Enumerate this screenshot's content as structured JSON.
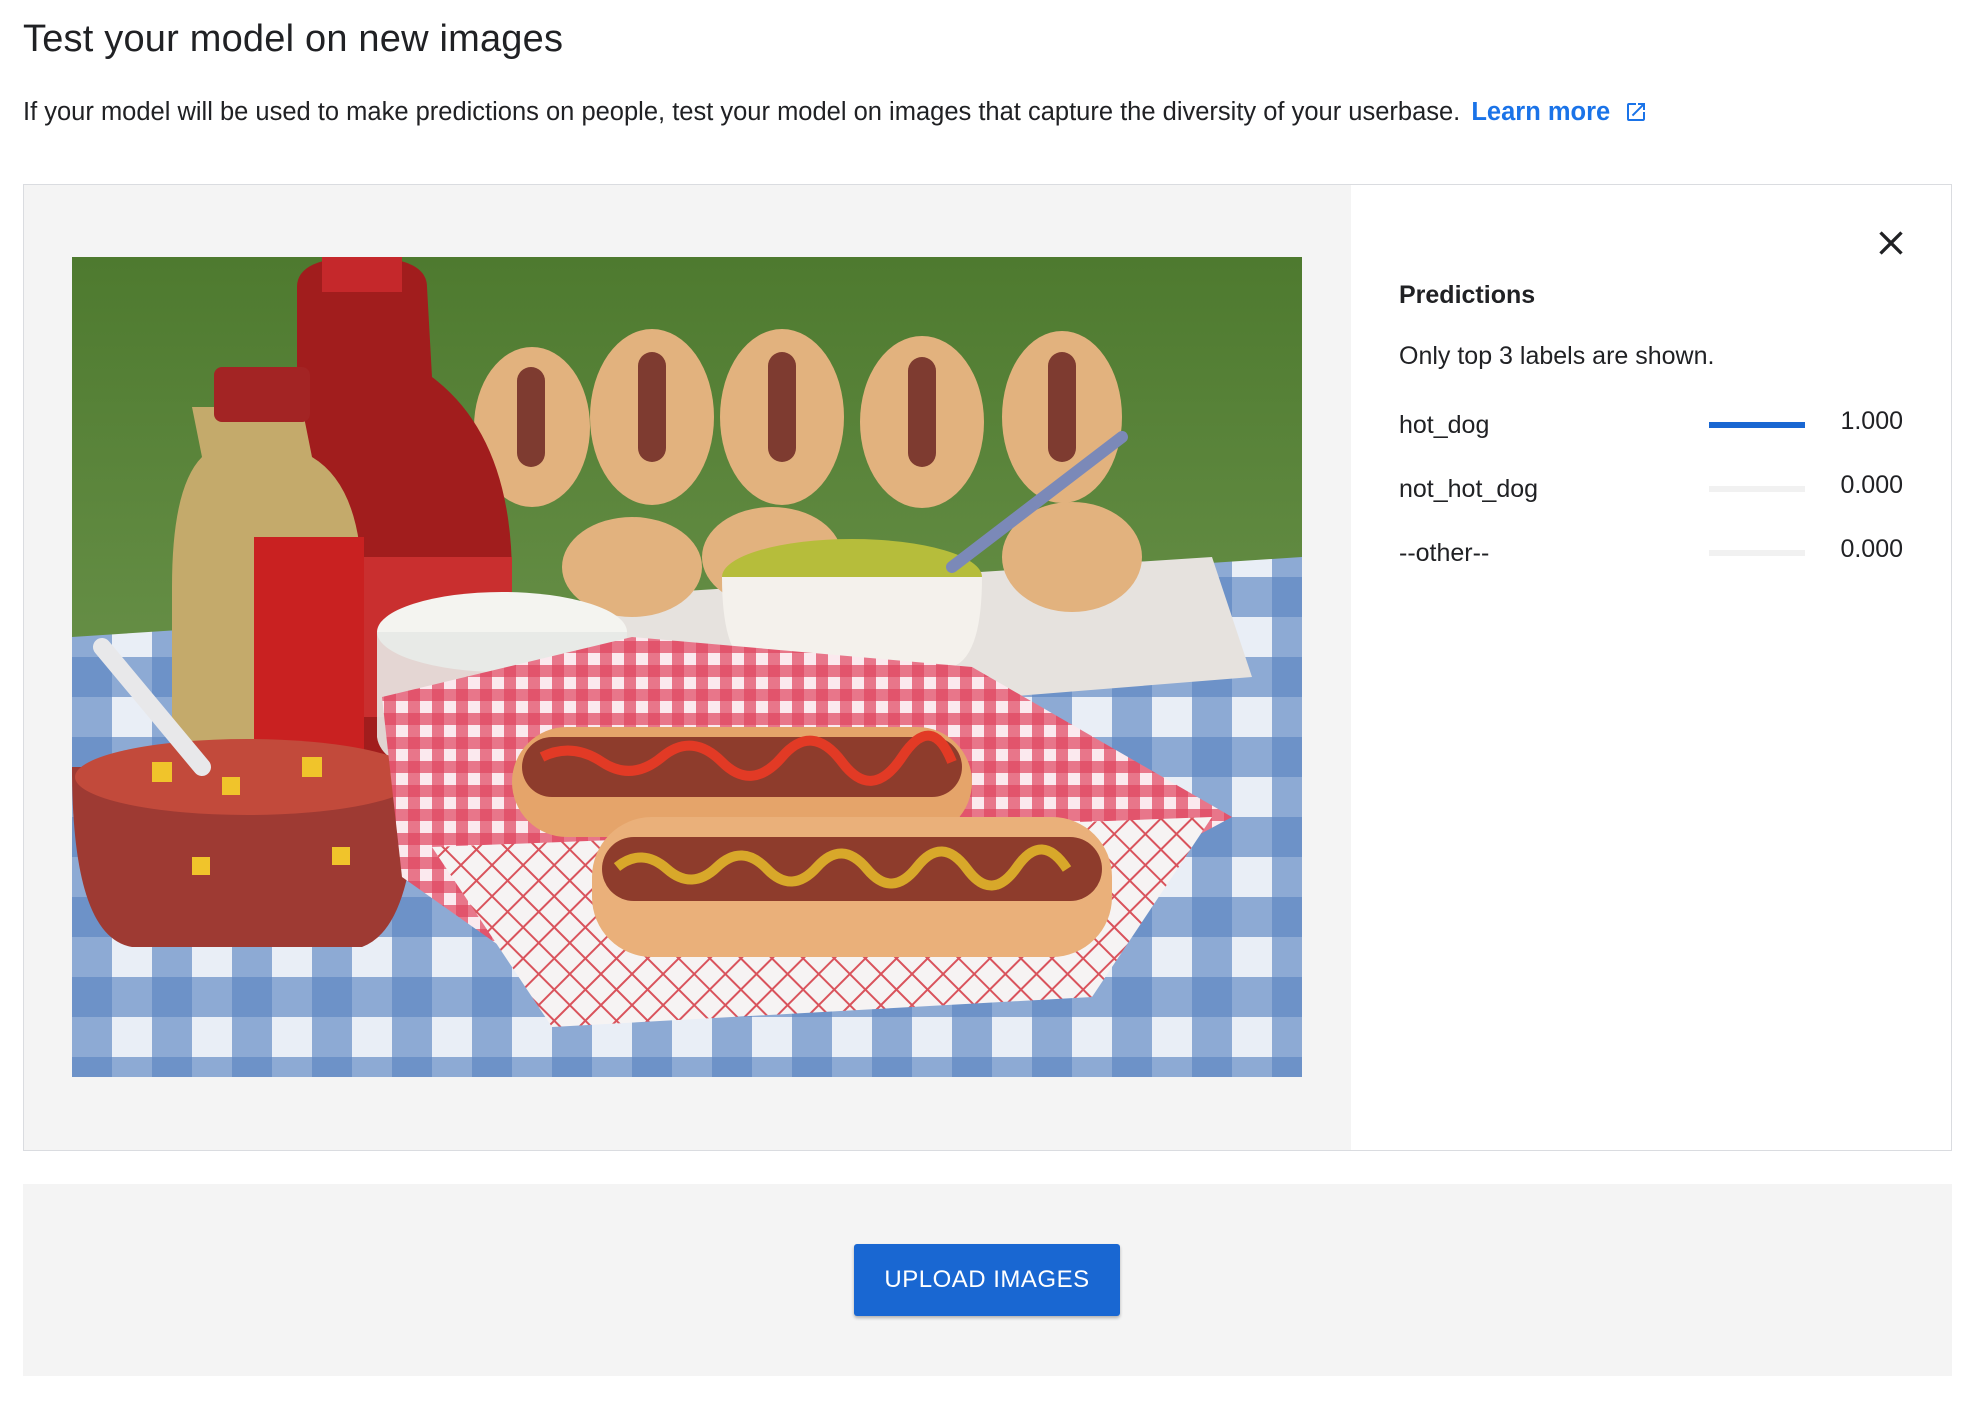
{
  "header": {
    "title": "Test your model on new images",
    "description": "If your model will be used to make predictions on people, test your model on images that capture the diversity of your userbase.",
    "learn_more_label": "Learn more"
  },
  "predictions": {
    "title": "Predictions",
    "note": "Only top 3 labels are shown.",
    "items": [
      {
        "label": "hot_dog",
        "score": 1.0,
        "score_text": "1.000"
      },
      {
        "label": "not_hot_dog",
        "score": 0.0,
        "score_text": "0.000"
      },
      {
        "label": "--other--",
        "score": 0.0,
        "score_text": "0.000"
      }
    ]
  },
  "upload": {
    "button_label": "UPLOAD IMAGES"
  },
  "colors": {
    "accent": "#1967d2",
    "link": "#1a73e8",
    "panel_bg": "#f4f4f4",
    "bar_track": "#f1f1f1"
  },
  "icons": {
    "external_link": "open-in-new-icon",
    "close": "close-icon"
  }
}
